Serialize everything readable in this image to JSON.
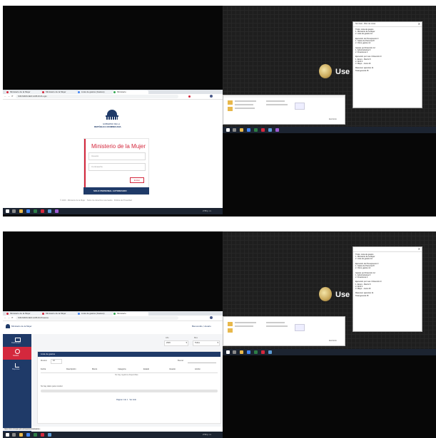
{
  "top": {
    "browser_tabs": [
      {
        "label": "Ministerio de la Mujer",
        "color": "#d4283d",
        "active": false
      },
      {
        "label": "Ministerio de la Mujer",
        "color": "#d4283d",
        "active": false
      },
      {
        "label": "Lista de gastos (Gastos)",
        "color": "#4285f4",
        "active": false
      },
      {
        "label": "Ministerio",
        "color": "#34a853",
        "active": true
      }
    ],
    "url": "SIM.MIMUJER.GOB.DO/Login",
    "logo_line1": "GOBIERNO DE LA",
    "logo_line2": "REPÚBLICA DOMINICANA",
    "login_title": "Ministerio de la Mujer",
    "user_placeholder": "Usuario",
    "pass_placeholder": "Contraseña",
    "login_button": "Entrar",
    "footer_banner": "SOLO PERSONAL AUTORIZADO",
    "footer_text": "© 2020 · Ministerio de la Mujer · Todos los derechos reservados · Política de Privacidad",
    "use_label": "Use",
    "explorer_status": "Escritorio",
    "taskbar_time": "2:58 p. m."
  },
  "bottom": {
    "url": "SIM.MIMUJER.GOB.DO/Gastos",
    "header_left": "Ministerio de la Mujer",
    "header_right": "Bienvenido, Usuario",
    "sidebar_items": [
      {
        "label": "Dashboard"
      },
      {
        "label": "Gastos"
      },
      {
        "label": "Reportes"
      }
    ],
    "filter_year_label": "Año",
    "filter_year_value": "2020",
    "filter_month_label": "Mes",
    "filter_month_value": "Todos",
    "card_title": "Lista de gastos",
    "show_label": "Mostrar",
    "show_value": "10",
    "search_label": "Buscar:",
    "columns": [
      "Fecha",
      "Descripción",
      "Monto",
      "Categoría",
      "Estado",
      "Usuario",
      "Acción"
    ],
    "empty_row": "No hay registros disponibles",
    "progress_label": "No hay datos para mostrar",
    "pagination": "Página 1 de 1 · Ver todo",
    "status_url": "https://sim.mimujer.gob.do/Gastos/ListaGastos",
    "taskbar_time": "2:59 p. m."
  },
  "notepad_lines": [
    "Título: Lista de gastos",
    "1. Ministerio de la Mujer",
    "2. Lista de gastos   10",
    "",
    "Ejecución de Presupuesto   3",
    "1. Gasto de Personal   8",
    "2. Otros gastos    14",
    "",
    "Gastos por Dirección  12",
    "1. Administrativa   6",
    "2. Financiera   4",
    "",
    "Ejecución por mes / Dirección  9",
    "1. Enero - Marzo   5",
    "2. Abril    3",
    "3. Mayo - Junio    20",
    "",
    "Resumen ejecutivo  11",
    "Total general     15"
  ]
}
